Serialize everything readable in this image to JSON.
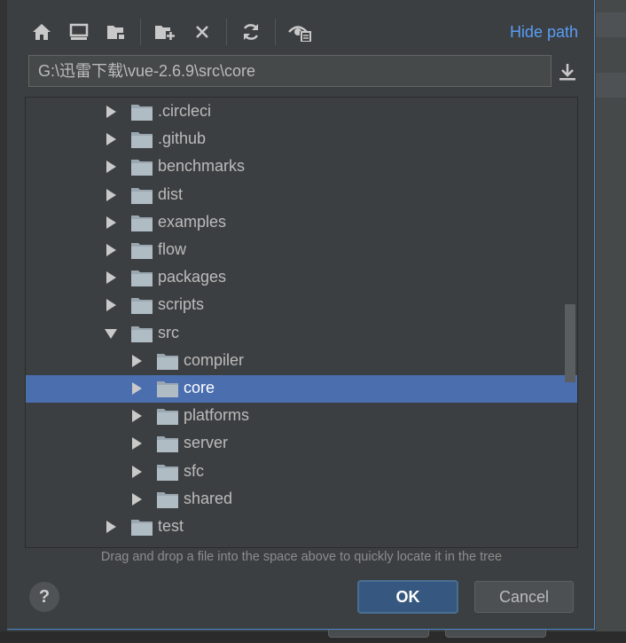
{
  "toolbar": {
    "buttons": [
      {
        "icon": "home-icon"
      },
      {
        "icon": "desktop-icon"
      },
      {
        "icon": "project-folder-icon"
      },
      {
        "icon": "new-folder-icon"
      },
      {
        "icon": "delete-icon"
      },
      {
        "icon": "refresh-icon"
      },
      {
        "icon": "show-hidden-icon"
      }
    ],
    "hide_path_label": "Hide path"
  },
  "path": {
    "value": "G:\\迅雷下载\\vue-2.6.9\\src\\core"
  },
  "tree": {
    "items": [
      {
        "label": ".circleci",
        "expanded": false,
        "selected": false
      },
      {
        "label": ".github",
        "expanded": false,
        "selected": false
      },
      {
        "label": "benchmarks",
        "expanded": false,
        "selected": false
      },
      {
        "label": "dist",
        "expanded": false,
        "selected": false
      },
      {
        "label": "examples",
        "expanded": false,
        "selected": false
      },
      {
        "label": "flow",
        "expanded": false,
        "selected": false
      },
      {
        "label": "packages",
        "expanded": false,
        "selected": false
      },
      {
        "label": "scripts",
        "expanded": false,
        "selected": false
      },
      {
        "label": "src",
        "expanded": true,
        "selected": false
      },
      {
        "label": "compiler",
        "expanded": false,
        "selected": false
      },
      {
        "label": "core",
        "expanded": false,
        "selected": true
      },
      {
        "label": "platforms",
        "expanded": false,
        "selected": false
      },
      {
        "label": "server",
        "expanded": false,
        "selected": false
      },
      {
        "label": "sfc",
        "expanded": false,
        "selected": false
      },
      {
        "label": "shared",
        "expanded": false,
        "selected": false
      },
      {
        "label": "test",
        "expanded": false,
        "selected": false
      }
    ]
  },
  "hint": "Drag and drop a file into the space above to quickly locate it in the tree",
  "buttons": {
    "help": "?",
    "ok": "OK",
    "cancel": "Cancel"
  },
  "colors": {
    "selection": "#4b6eaf",
    "link": "#589df6",
    "primary_button": "#365880"
  }
}
